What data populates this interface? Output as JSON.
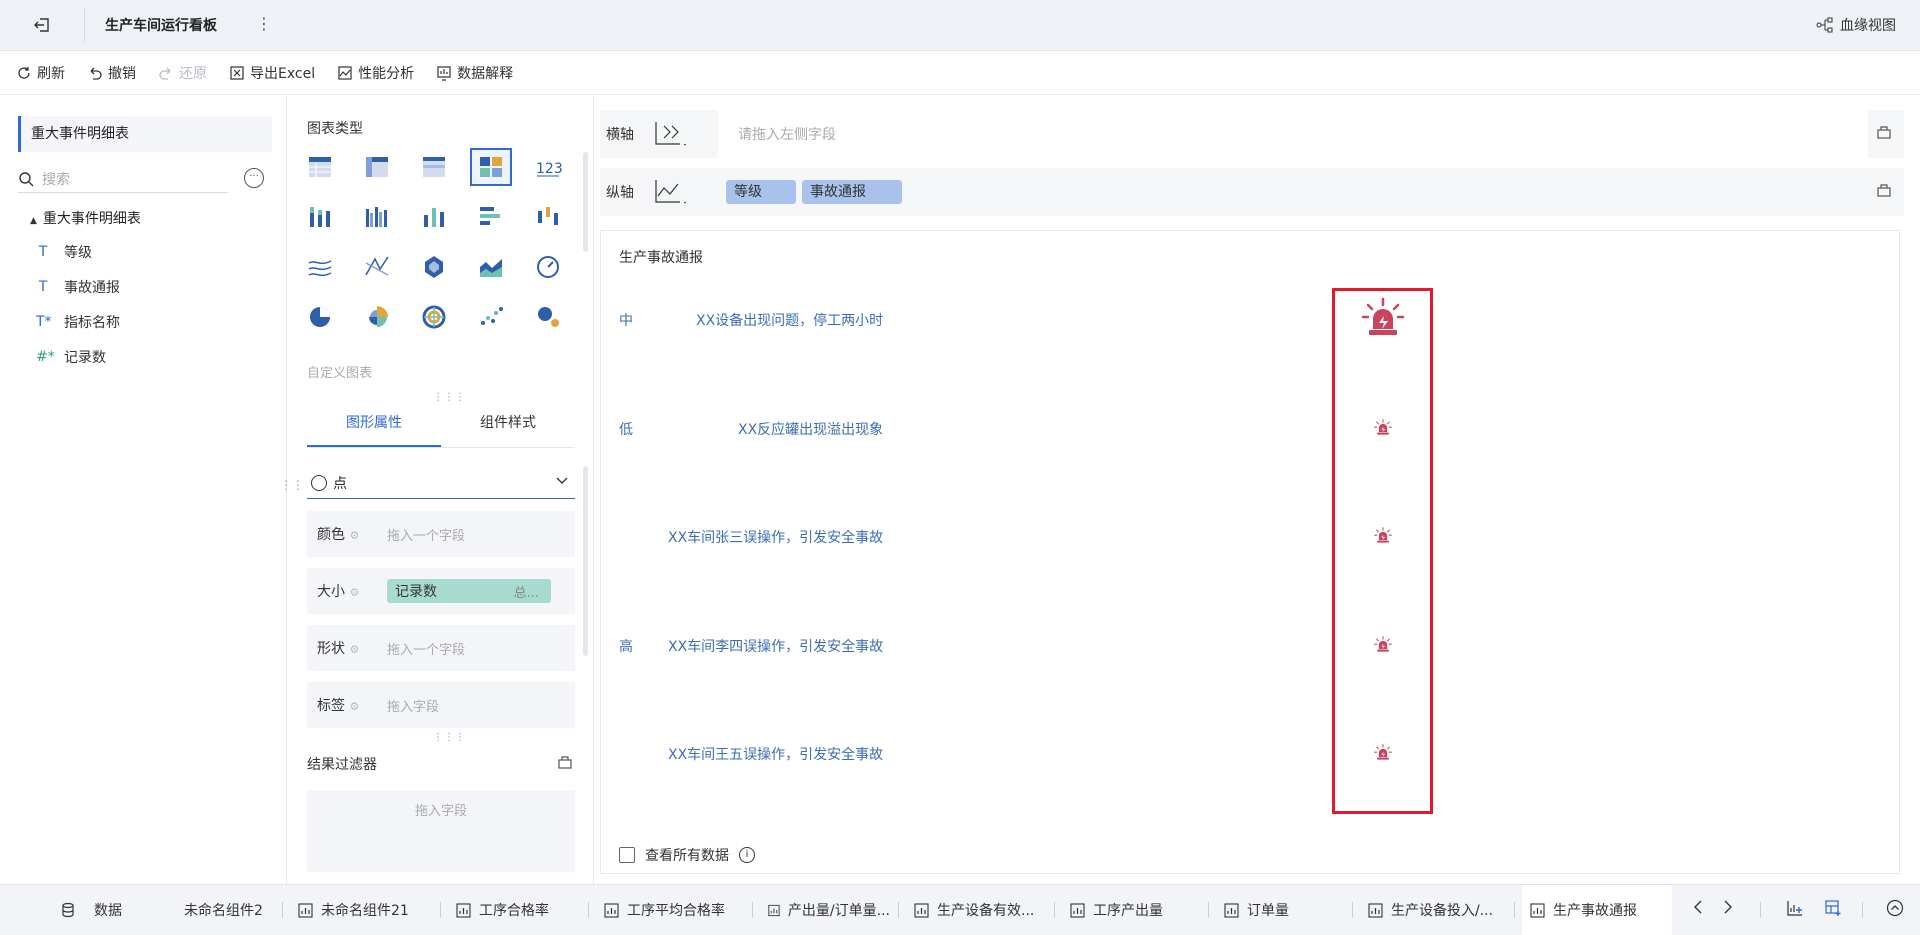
{
  "header": {
    "title": "生产车间运行看板",
    "lineage_label": "血缘视图"
  },
  "toolbar": {
    "refresh": "刷新",
    "undo": "撤销",
    "redo": "还原",
    "export_excel": "导出Excel",
    "performance": "性能分析",
    "explain": "数据解释"
  },
  "data_panel": {
    "dataset_title": "重大事件明细表",
    "search_placeholder": "搜索",
    "tree_root": "重大事件明细表",
    "fields": [
      {
        "label": "等级",
        "icon": "T"
      },
      {
        "label": "事故通报",
        "icon": "T"
      },
      {
        "label": "指标名称",
        "icon": "T*"
      },
      {
        "label": "记录数",
        "icon": "#*"
      }
    ]
  },
  "chart_panel": {
    "chart_type_label": "图表类型",
    "custom_chart_label": "自定义图表",
    "tabs": [
      "图形属性",
      "组件样式"
    ],
    "mark_type": "点",
    "properties": {
      "color_label": "颜色",
      "color_placeholder": "拖入一个字段",
      "size_label": "大小",
      "size_field": "记录数",
      "size_agg": "总...",
      "shape_label": "形状",
      "shape_placeholder": "拖入一个字段",
      "label_label": "标签",
      "label_placeholder": "拖入字段"
    },
    "filter_label": "结果过滤器",
    "filter_placeholder": "拖入字段"
  },
  "axes": {
    "x_label": "横轴",
    "x_placeholder": "请拖入左侧字段",
    "y_label": "纵轴",
    "y_fields": [
      "等级",
      "事故通报"
    ]
  },
  "canvas": {
    "title": "生产事故通报",
    "rows": [
      {
        "level": "中",
        "event": "XX设备出现问题，停工两小时",
        "count": 2
      },
      {
        "level": "低",
        "event": "XX反应罐出现溢出现象",
        "count": 1
      },
      {
        "level": "",
        "event": "XX车间张三误操作，引发安全事故",
        "count": 1
      },
      {
        "level": "高",
        "event": "XX车间李四误操作，引发安全事故",
        "count": 1
      },
      {
        "level": "",
        "event": "XX车间王五误操作，引发安全事故",
        "count": 1
      }
    ],
    "view_all_label": "查看所有数据",
    "alarm_color": "#c9455e",
    "highlight_color": "#e01a2b"
  },
  "bottom_tabs": {
    "data_label": "数据",
    "tabs": [
      "未命名组件2",
      "未命名组件21",
      "工序合格率",
      "工序平均合格率",
      "产出量/订单量...",
      "生产设备有效...",
      "工序产出量",
      "订单量",
      "生产设备投入/...",
      "生产事故通报"
    ],
    "active_index": 9
  }
}
